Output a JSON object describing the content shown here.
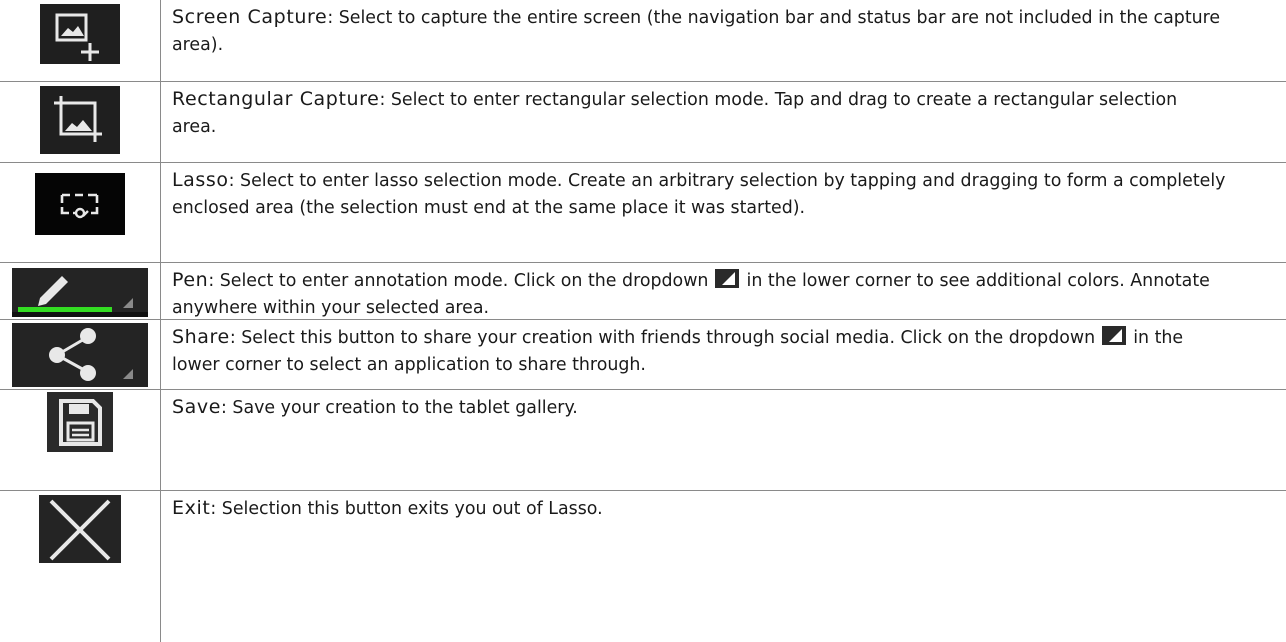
{
  "rows": [
    {
      "name": "screen-capture",
      "icon": "screen-capture-icon",
      "title": "Screen Capture",
      "sep": ":",
      "text": "  Select to capture the entire screen (the navigation bar and status bar are not included in the capture area)."
    },
    {
      "name": "rectangular-capture",
      "icon": "crop-icon",
      "title": "Rectangular Capture",
      "sep": ":",
      "text": "  Select to enter rectangular selection mode. Tap and drag to create a rectangular selection area."
    },
    {
      "name": "lasso",
      "icon": "lasso-icon",
      "title": "Lasso",
      "sep": ":",
      "text": "   Select to enter lasso selection mode. Create an arbitrary selection by tapping and dragging to form a completely enclosed area (the selection must end at the same place it was started)."
    },
    {
      "name": "pen",
      "icon": "pen-icon",
      "title": "Pen",
      "sep": ":",
      "text_before": "   Select to enter annotation mode. Click on the dropdown ",
      "text_after": " in the lower corner to see additional colors. Annotate anywhere within your selected area."
    },
    {
      "name": "share",
      "icon": "share-icon",
      "title": "Share",
      "sep": ":",
      "text_before": "   Select this button to share your creation with friends through social media. Click on the dropdown ",
      "text_after": " in the lower corner to select an application to share through."
    },
    {
      "name": "save",
      "icon": "save-icon",
      "title": "Save",
      "sep": ":",
      "text": "  Save your creation to the tablet gallery."
    },
    {
      "name": "exit",
      "icon": "close-icon",
      "title": "Exit",
      "sep": ":",
      "text": "  Selection this button exits you out of Lasso."
    }
  ],
  "colors": {
    "icon_bg": "#1f1f1f",
    "icon_fg": "#e8e8e8",
    "pen_green": "#33dd22",
    "rule": "#8a8a8a"
  }
}
